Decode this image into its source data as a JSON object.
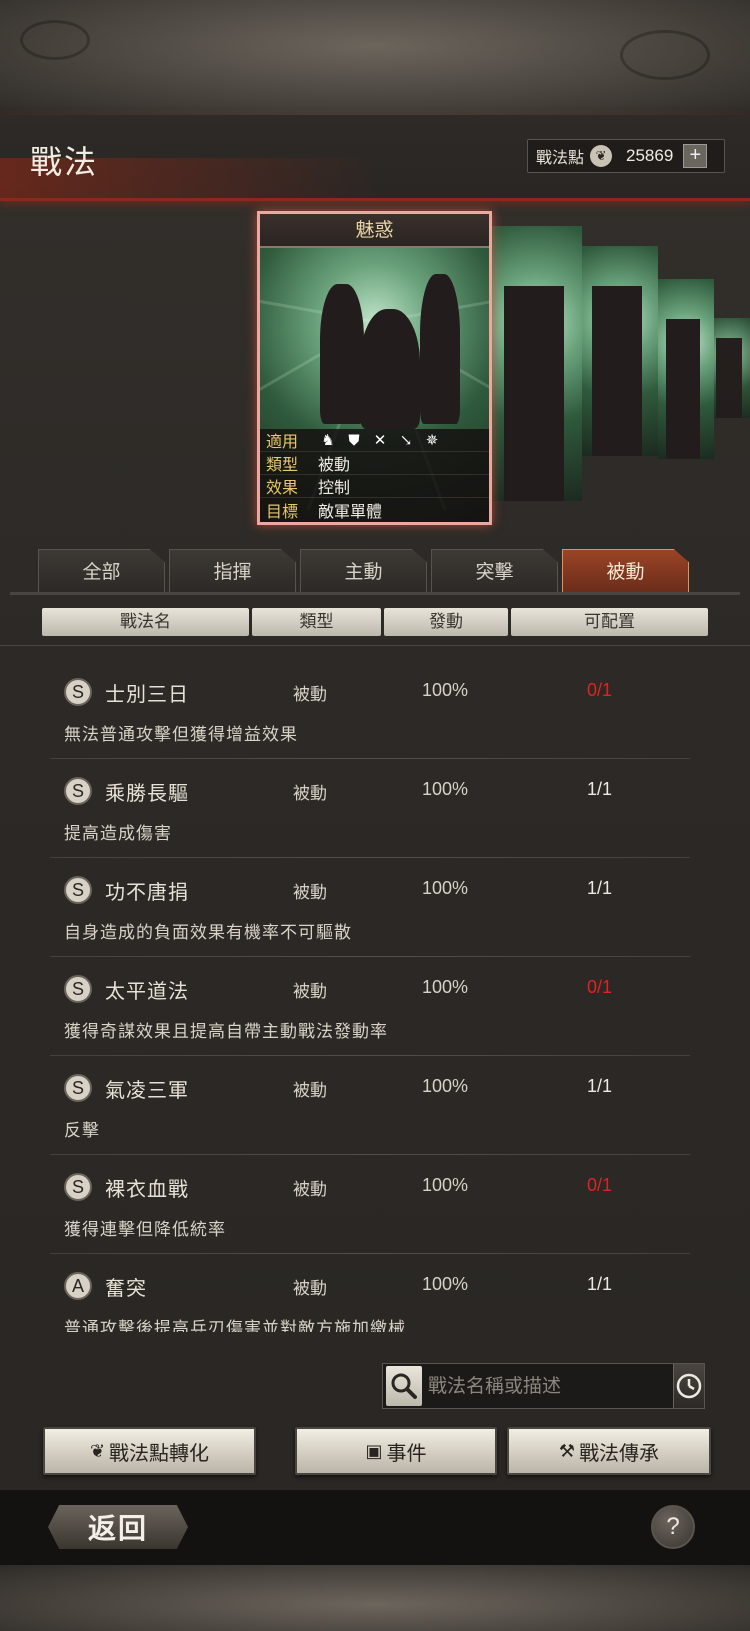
{
  "header": {
    "title": "戰法",
    "points_label": "戰法點",
    "points_value": "25869",
    "points_plus": "+"
  },
  "card": {
    "name": "魅惑",
    "info": [
      {
        "key": "適用",
        "value": ""
      },
      {
        "key": "類型",
        "value": "被動"
      },
      {
        "key": "效果",
        "value": "控制"
      },
      {
        "key": "目標",
        "value": "敵軍單體"
      }
    ],
    "troop_icons": [
      "cavalry-icon",
      "shield-icon",
      "bow-icon",
      "spear-icon",
      "chariot-icon"
    ]
  },
  "tabs": [
    {
      "label": "全部",
      "active": false
    },
    {
      "label": "指揮",
      "active": false
    },
    {
      "label": "主動",
      "active": false
    },
    {
      "label": "突擊",
      "active": false
    },
    {
      "label": "被動",
      "active": true
    }
  ],
  "columns": {
    "name": "戰法名",
    "type": "類型",
    "rate": "發動",
    "avail": "可配置"
  },
  "tactics": [
    {
      "grade": "S",
      "name": "士別三日",
      "type": "被動",
      "rate": "100%",
      "avail": "0/1",
      "avail_color": "red",
      "desc": "無法普通攻擊但獲得增益效果"
    },
    {
      "grade": "S",
      "name": "乘勝長驅",
      "type": "被動",
      "rate": "100%",
      "avail": "1/1",
      "avail_color": "white",
      "desc": "提高造成傷害"
    },
    {
      "grade": "S",
      "name": "功不唐捐",
      "type": "被動",
      "rate": "100%",
      "avail": "1/1",
      "avail_color": "white",
      "desc": "自身造成的負面效果有機率不可驅散"
    },
    {
      "grade": "S",
      "name": "太平道法",
      "type": "被動",
      "rate": "100%",
      "avail": "0/1",
      "avail_color": "red",
      "desc": "獲得奇謀效果且提高自帶主動戰法發動率"
    },
    {
      "grade": "S",
      "name": "氣凌三軍",
      "type": "被動",
      "rate": "100%",
      "avail": "1/1",
      "avail_color": "white",
      "desc": "反擊"
    },
    {
      "grade": "S",
      "name": "裸衣血戰",
      "type": "被動",
      "rate": "100%",
      "avail": "0/1",
      "avail_color": "red",
      "desc": "獲得連擊但降低統率"
    },
    {
      "grade": "A",
      "name": "奮突",
      "type": "被動",
      "rate": "100%",
      "avail": "1/1",
      "avail_color": "white",
      "desc": "普通攻擊後提高兵刃傷害並對敵方施加繳械"
    }
  ],
  "search": {
    "placeholder": "戰法名稱或描述"
  },
  "actions": {
    "convert": "戰法點轉化",
    "event": "事件",
    "inherit": "戰法傳承"
  },
  "footer": {
    "back": "返回",
    "help": "?"
  }
}
